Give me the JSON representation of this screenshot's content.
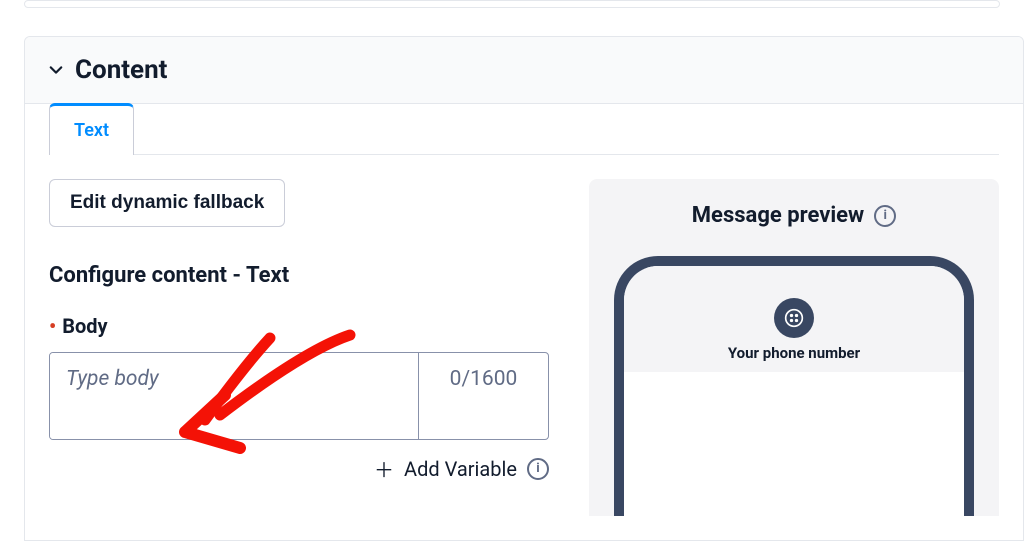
{
  "panel": {
    "title": "Content"
  },
  "tabs": {
    "text": "Text"
  },
  "buttons": {
    "fallback": "Edit dynamic fallback",
    "addVariable": "Add Variable"
  },
  "section": {
    "title": "Configure content - Text"
  },
  "body": {
    "label": "Body",
    "placeholder": "Type body",
    "charCount": "0/1600"
  },
  "preview": {
    "title": "Message preview",
    "phoneLabel": "Your phone number"
  }
}
